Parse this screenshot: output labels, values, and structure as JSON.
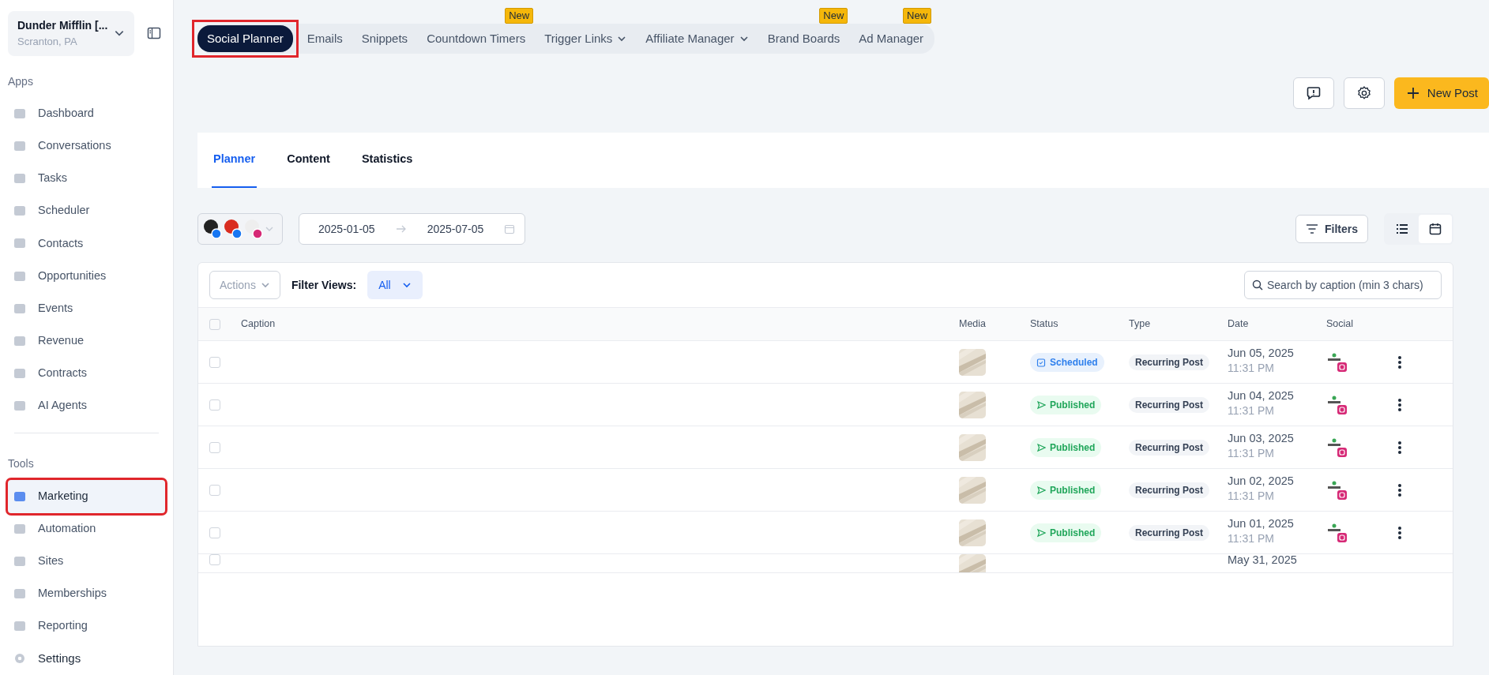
{
  "account": {
    "name": "Dunder Mifflin [...",
    "location": "Scranton, PA"
  },
  "sidebar": {
    "sections": [
      {
        "title": "Apps",
        "items": [
          {
            "label": "Dashboard",
            "selected": false,
            "highlighted": false
          },
          {
            "label": "Conversations",
            "selected": false,
            "highlighted": false
          },
          {
            "label": "Tasks",
            "selected": false,
            "highlighted": false
          },
          {
            "label": "Scheduler",
            "selected": false,
            "highlighted": false
          },
          {
            "label": "Contacts",
            "selected": false,
            "highlighted": false
          },
          {
            "label": "Opportunities",
            "selected": false,
            "highlighted": false
          },
          {
            "label": "Events",
            "selected": false,
            "highlighted": false
          },
          {
            "label": "Revenue",
            "selected": false,
            "highlighted": false
          },
          {
            "label": "Contracts",
            "selected": false,
            "highlighted": false
          },
          {
            "label": "AI Agents",
            "selected": false,
            "highlighted": false
          }
        ]
      },
      {
        "title": "Tools",
        "items": [
          {
            "label": "Marketing",
            "selected": true,
            "highlighted": true
          },
          {
            "label": "Automation",
            "selected": false,
            "highlighted": false
          },
          {
            "label": "Sites",
            "selected": false,
            "highlighted": false
          },
          {
            "label": "Memberships",
            "selected": false,
            "highlighted": false
          },
          {
            "label": "Reporting",
            "selected": false,
            "highlighted": false
          }
        ]
      }
    ],
    "settings": {
      "label": "Settings"
    }
  },
  "top_tabs": [
    {
      "label": "Social Planner",
      "selected": true,
      "highlighted": true,
      "dropdown": false
    },
    {
      "label": "Emails",
      "selected": false,
      "highlighted": false,
      "dropdown": false
    },
    {
      "label": "Snippets",
      "selected": false,
      "highlighted": false,
      "dropdown": false
    },
    {
      "label": "Countdown Timers",
      "selected": false,
      "highlighted": false,
      "dropdown": false,
      "badge": "New"
    },
    {
      "label": "Trigger Links",
      "selected": false,
      "highlighted": false,
      "dropdown": true
    },
    {
      "label": "Affiliate Manager",
      "selected": false,
      "highlighted": false,
      "dropdown": true
    },
    {
      "label": "Brand Boards",
      "selected": false,
      "highlighted": false,
      "dropdown": false,
      "badge": "New"
    },
    {
      "label": "Ad Manager",
      "selected": false,
      "highlighted": false,
      "dropdown": false,
      "badge": "New"
    }
  ],
  "new_post": {
    "label": "New Post"
  },
  "sub_tabs": [
    {
      "label": "Planner",
      "selected": true
    },
    {
      "label": "Content",
      "selected": false
    },
    {
      "label": "Statistics",
      "selected": false
    }
  ],
  "accounts": [
    {
      "kind": "facebook"
    },
    {
      "kind": "facebook"
    },
    {
      "kind": "instagram"
    }
  ],
  "date_range": {
    "start": "2025-01-05",
    "end": "2025-07-05"
  },
  "filters": {
    "label": "Filters"
  },
  "views": [
    {
      "kind": "list",
      "selected": true
    },
    {
      "kind": "calendar",
      "selected": false
    }
  ],
  "table": {
    "actions": "Actions",
    "filter_views_label": "Filter Views:",
    "filter_view": "All",
    "search": {
      "placeholder": "Search by caption (min 3 chars)"
    },
    "select_all_checked": false,
    "columns": [
      "Caption",
      "Media",
      "Status",
      "Type",
      "Date",
      "Social"
    ],
    "rows": [
      {
        "checked": false,
        "status": "Scheduled",
        "kind": "scheduled",
        "type": "Recurring Post",
        "date": "Jun 05, 2025",
        "time": "11:31 PM"
      },
      {
        "checked": false,
        "status": "Published",
        "kind": "published",
        "type": "Recurring Post",
        "date": "Jun 04, 2025",
        "time": "11:31 PM"
      },
      {
        "checked": false,
        "status": "Published",
        "kind": "published",
        "type": "Recurring Post",
        "date": "Jun 03, 2025",
        "time": "11:31 PM"
      },
      {
        "checked": false,
        "status": "Published",
        "kind": "published",
        "type": "Recurring Post",
        "date": "Jun 02, 2025",
        "time": "11:31 PM"
      },
      {
        "checked": false,
        "status": "Published",
        "kind": "published",
        "type": "Recurring Post",
        "date": "Jun 01, 2025",
        "time": "11:31 PM"
      },
      {
        "checked": false,
        "date": "May 31, 2025",
        "kind": "partial"
      }
    ]
  }
}
